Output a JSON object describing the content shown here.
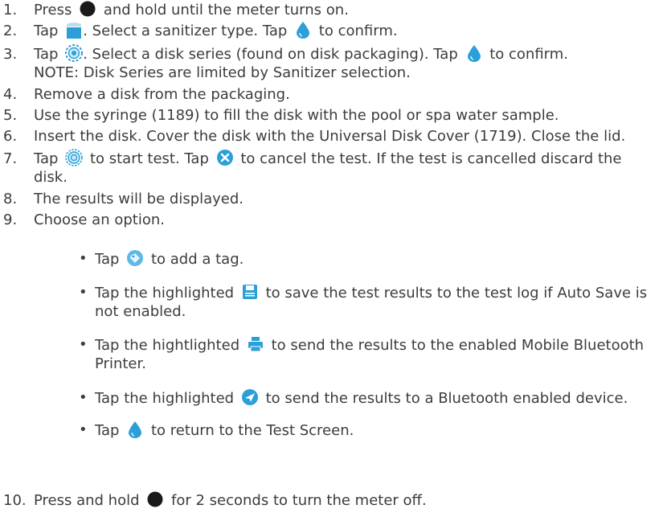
{
  "colors": {
    "text": "#3c3c3c",
    "icon_blue": "#2a9fd8",
    "icon_dark": "#1a1a1a"
  },
  "steps": [
    {
      "num": "1.",
      "a": "Press",
      "b": "and hold until the meter turns on.",
      "icons": [
        "power-button-icon"
      ]
    },
    {
      "num": "2.",
      "a": "Tap",
      "b": ". Select a sanitizer type. Tap",
      "c": "to confirm.",
      "icons": [
        "sanitizer-bucket-icon",
        "water-drop-icon"
      ]
    },
    {
      "num": "3.",
      "a": "Tap",
      "b": ". Select a disk series (found on disk packaging). Tap",
      "c": "to confirm.",
      "line2": "NOTE: Disk Series are limited by Sanitizer selection.",
      "icons": [
        "disk-series-icon",
        "water-drop-icon"
      ]
    },
    {
      "num": "4.",
      "a": "Remove a disk from the packaging."
    },
    {
      "num": "5.",
      "a": "Use the syringe (1189) to fill the disk with the pool or spa water sample."
    },
    {
      "num": "6.",
      "a": "Insert the disk. Cover the disk with the Universal Disk Cover (1719). Close the lid."
    },
    {
      "num": "7.",
      "a": "Tap",
      "b": "to start test. Tap",
      "c": "to cancel the test. If the test is cancelled discard the",
      "line2": "disk.",
      "icons": [
        "start-test-icon",
        "cancel-x-icon"
      ]
    },
    {
      "num": "8.",
      "a": "The results will be displayed."
    },
    {
      "num": "9.",
      "a": "Choose an option."
    },
    {
      "num": "10.",
      "a": "Press and hold",
      "b": "for 2 seconds to turn the meter off.",
      "icons": [
        "power-button-icon"
      ]
    }
  ],
  "options": [
    {
      "a": "Tap",
      "b": "to add a tag.",
      "icons": [
        "tag-icon"
      ]
    },
    {
      "a": "Tap the highlighted",
      "b": "to save the test results to the test log if Auto Save is",
      "line2": "not enabled.",
      "icons": [
        "save-icon"
      ]
    },
    {
      "a": "Tap the hightlighted",
      "b": "to send the results to the enabled Mobile Bluetooth",
      "line2": "Printer.",
      "icons": [
        "printer-icon"
      ]
    },
    {
      "a": "Tap the highlighted",
      "b": "to send the results to a Bluetooth enabled device.",
      "icons": [
        "send-icon"
      ]
    },
    {
      "a": "Tap",
      "b": "to return to the Test Screen.",
      "icons": [
        "water-drop-icon"
      ]
    }
  ],
  "bullet": "•"
}
